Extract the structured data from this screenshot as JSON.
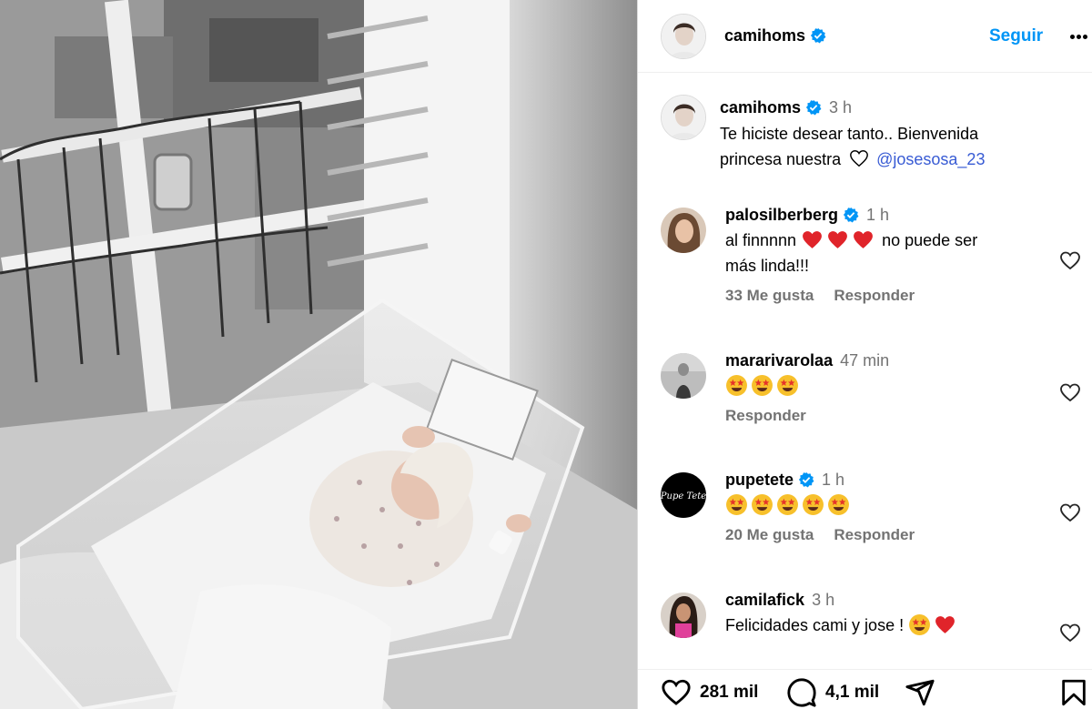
{
  "post": {
    "author": "camihoms",
    "follow_label": "Seguir"
  },
  "caption": {
    "author": "camihoms",
    "time": "3 h",
    "text_1": "Te hiciste desear tanto.. Bienvenida",
    "text_2": "princesa nuestra",
    "mention": "@josesosa_23"
  },
  "comments": [
    {
      "author": "palosilberberg",
      "verified": true,
      "time": "1 h",
      "text": "al finnnnn",
      "text_after": "no puede ser",
      "text_line2": "más linda!!!",
      "likes": "33 Me gusta",
      "reply": "Responder",
      "emojis": [
        "red-heart",
        "red-heart",
        "red-heart"
      ]
    },
    {
      "author": "mararivarolaa",
      "verified": false,
      "time": "47 min",
      "emojis": [
        "star-struck",
        "star-struck",
        "star-struck"
      ],
      "reply": "Responder"
    },
    {
      "author": "pupetete",
      "verified": true,
      "time": "1 h",
      "emojis": [
        "star-struck",
        "star-struck",
        "star-struck",
        "star-struck",
        "star-struck"
      ],
      "likes": "20 Me gusta",
      "reply": "Responder",
      "avatar_text": "Pupe Tete"
    },
    {
      "author": "camilafick",
      "verified": false,
      "time": "3 h",
      "text": "Felicidades cami y jose !",
      "emojis": [
        "star-struck",
        "red-heart"
      ]
    }
  ],
  "actions": {
    "like_count": "281 mil",
    "comment_count": "4,1 mil"
  },
  "icons": [
    "verified-badge-icon",
    "more-options-icon",
    "heart-outline-icon",
    "like-icon",
    "comment-icon",
    "share-icon",
    "save-icon",
    "star-struck-emoji",
    "red-heart-emoji",
    "white-heart-emoji"
  ],
  "colors": {
    "accent": "#0095f6",
    "mention": "#00376b",
    "muted": "#737373",
    "heart": "#e0245e"
  }
}
